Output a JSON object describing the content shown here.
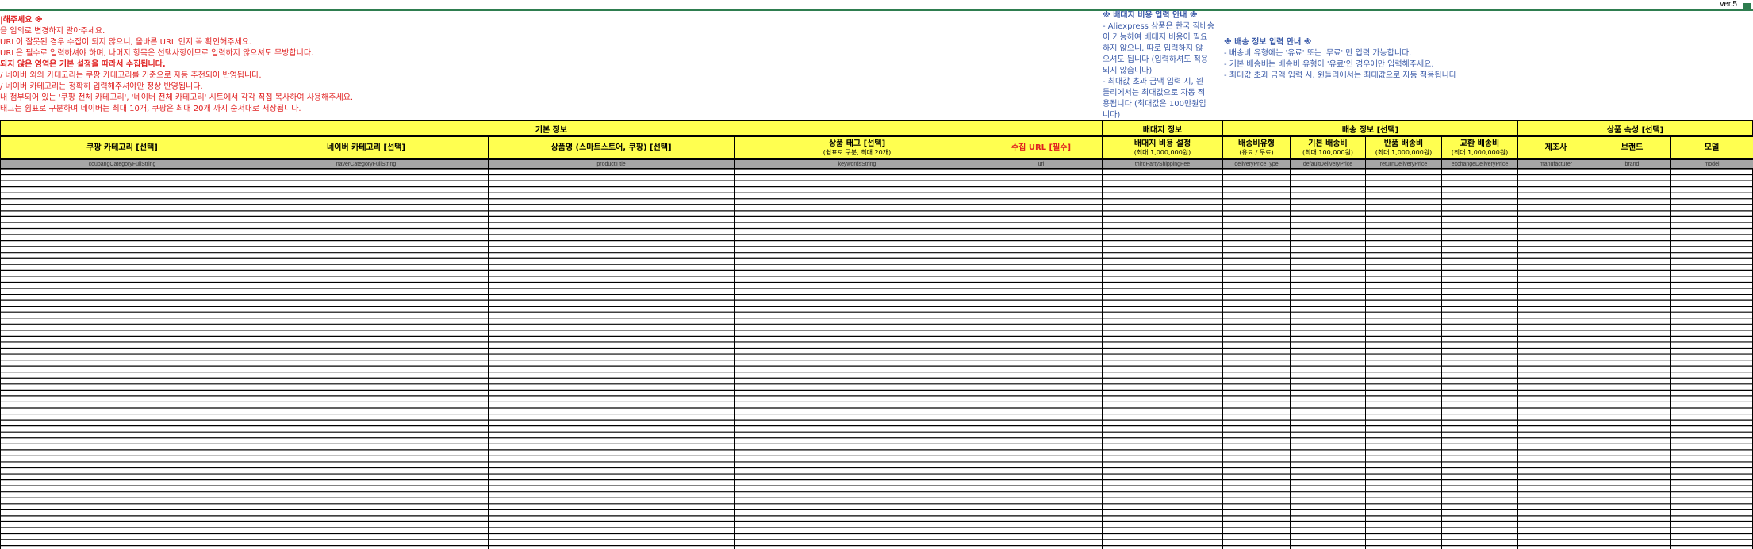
{
  "version": "ver.5",
  "notes_red": [
    {
      "text": "|해주세요 ※",
      "bold": true
    },
    {
      "text": "을 임의로 변경하지 말아주세요.",
      "bold": false
    },
    {
      "text": " URL이 잘못된 경우 수집이 되지 않으니, 올바른 URL 인지 꼭 확인해주세요.",
      "bold": false
    },
    {
      "text": " URL은 필수로 입력하셔야 하며, 나머지 항목은 선택사항이므로 입력하지 않으셔도 무방합니다.",
      "bold": false
    },
    {
      "text": "되지 않은 영역은 기본 설정을 따라서 수집됩니다.",
      "bold": true
    },
    {
      "text": " / 네이버 외의 카테고리는 쿠팡 카테고리를 기준으로 자동 추천되어 반영됩니다.",
      "bold": false
    },
    {
      "text": " / 네이버 카테고리는 정확히 입력해주셔야만 정상 반영됩니다.",
      "bold": false
    },
    {
      "text": " 내 첨부되어 있는 '쿠팡 전체 카테고리', '네이버 전체 카테고리' 시트에서 각각 직접 복사하여 사용해주세요.",
      "bold": false
    },
    {
      "text": " 태그는 쉼표로 구분하며 네이버는 최대 10개, 쿠팡은 최대 20개 까지 순서대로 저장됩니다.",
      "bold": false
    }
  ],
  "notes_third": {
    "title": "※ 배대지 비용 입력 안내 ※",
    "lines": [
      "- Aliexpress 상품은 한국 직배송",
      "이 가능하여 배대지 비용이 필요",
      "하지 않으니, 따로 입력하지 않",
      "으셔도 됩니다 (입력하셔도 적용",
      "되지 않습니다)",
      "- 최대값 초과 금액 입력 시, 윈",
      "들리에서는 최대값으로 자동 적",
      "용됩니다 (최대값은 100만원입",
      "니다)"
    ]
  },
  "notes_ship": {
    "title": "※ 배송 정보 입력 안내 ※",
    "lines": [
      "- 배송비 유형에는 '유료' 또는 '무료' 만 입력 가능합니다.",
      "- 기본 배송비는 배송비 유형이 '유료'인 경우에만 입력해주세요.",
      "- 최대값 초과 금액 입력 시, 윈들리에서는 최대값으로 자동 적용됩니다"
    ]
  },
  "groups": [
    {
      "label": "기본 정보"
    },
    {
      "label": "배대지 정보"
    },
    {
      "label": "배송 정보 [선택]"
    },
    {
      "label": "상품 속성 [선택]"
    }
  ],
  "columns": [
    {
      "label": "쿠팡 카테고리 [선택]",
      "sub": "",
      "key": "coupangCategoryFullString",
      "required": false
    },
    {
      "label": "네이버 카테고리 [선택]",
      "sub": "",
      "key": "naverCategoryFullString",
      "required": false
    },
    {
      "label": "상품명 (스마트스토어, 쿠팡) [선택]",
      "sub": "",
      "key": "productTitle",
      "required": false
    },
    {
      "label": "상품 태그 [선택]",
      "sub": "(쉼표로 구분, 최대 20개)",
      "key": "keywordsString",
      "required": false
    },
    {
      "label": "수집 URL [필수]",
      "sub": "",
      "key": "url",
      "required": true
    },
    {
      "label": "배대지 비용 설정",
      "sub": "(최대 1,000,000원)",
      "key": "thirdPartyShippingFee",
      "required": false
    },
    {
      "label": "배송비유형",
      "sub": "(유료 / 무료)",
      "key": "deliveryPriceType",
      "required": false
    },
    {
      "label": "기본 배송비",
      "sub": "(최대 100,000원)",
      "key": "defaultDeliveryPrice",
      "required": false
    },
    {
      "label": "반품 배송비",
      "sub": "(최대 1,000,000원)",
      "key": "returnDeliveryPrice",
      "required": false
    },
    {
      "label": "교환 배송비",
      "sub": "(최대 1,000,000원)",
      "key": "exchangeDeliveryPrice",
      "required": false
    },
    {
      "label": "제조사",
      "sub": "",
      "key": "manufacturer",
      "required": false
    },
    {
      "label": "브랜드",
      "sub": "",
      "key": "brand",
      "required": false
    },
    {
      "label": "모델",
      "sub": "",
      "key": "model",
      "required": false
    }
  ],
  "colors": {
    "header_bg": "#ffff50",
    "key_row_bg": "#a6a6a6",
    "notes_red": "#e02020",
    "notes_blue": "#3a5aa8",
    "top_bar": "#2e7d4f"
  }
}
